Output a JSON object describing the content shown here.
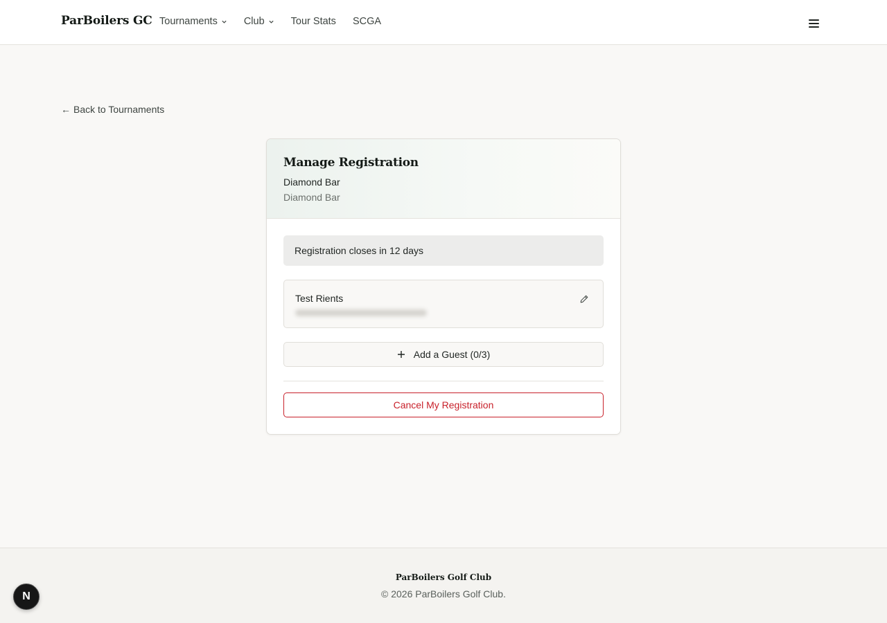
{
  "header": {
    "brand": "ParBoilers GC",
    "nav": [
      {
        "label": "Tournaments",
        "has_dropdown": true
      },
      {
        "label": "Club",
        "has_dropdown": true
      },
      {
        "label": "Tour Stats",
        "has_dropdown": false
      },
      {
        "label": "SCGA",
        "has_dropdown": false
      }
    ],
    "menu_icon": "hamburger-icon"
  },
  "back_link": {
    "arrow": "←",
    "label": "Back to Tournaments"
  },
  "registration": {
    "title": "Manage Registration",
    "course_name": "Diamond Bar",
    "course_location": "Diamond Bar",
    "status": "Registration closes in 12 days",
    "player": {
      "name": "Test Rients",
      "detail_blurred": true
    },
    "add_guest": {
      "icon": "plus-icon",
      "label": "Add a Guest (0/3)"
    },
    "cancel_label": "Cancel My Registration"
  },
  "footer": {
    "title": "ParBoilers Golf Club",
    "copyright": "© 2026 ParBoilers Golf Club."
  },
  "dev_badge": {
    "letter": "N"
  },
  "colors": {
    "background": "#f9f8f6",
    "card": "#ffffff",
    "danger": "#c8202a",
    "text": "#1f2421",
    "muted": "#6b706c"
  }
}
